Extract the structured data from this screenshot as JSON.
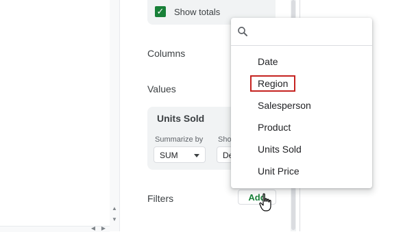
{
  "panel": {
    "show_totals_label": "Show totals",
    "columns_label": "Columns",
    "values_label": "Values",
    "filters_label": "Filters",
    "add_button": "Add"
  },
  "value_card": {
    "title": "Units Sold",
    "summarize_label": "Summarize by",
    "summarize_value": "SUM",
    "show_as_label": "Sho",
    "show_as_value": "De"
  },
  "dropdown": {
    "search_placeholder": "",
    "items": [
      "Date",
      "Region",
      "Salesperson",
      "Product",
      "Units Sold",
      "Unit Price"
    ],
    "highlighted_item": "Region"
  },
  "colors": {
    "accent": "#188038",
    "highlight_border": "#c5221f"
  },
  "icons": {
    "search": "search-icon",
    "checkbox": "checkbox-checked-icon",
    "cursor": "hand-pointer-icon"
  }
}
